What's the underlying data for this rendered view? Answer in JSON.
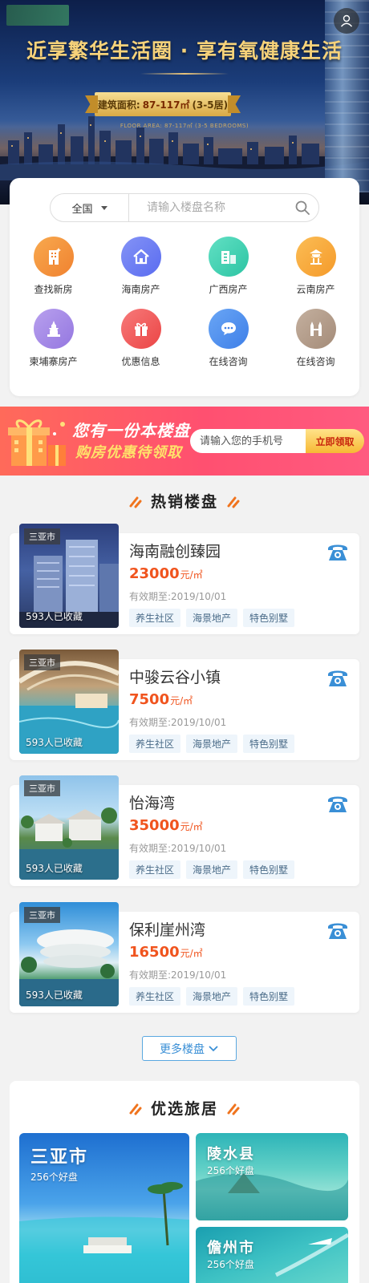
{
  "hero": {
    "headline": "近享繁华生活圈 · 享有氧健康生活",
    "area_label": "建筑面积:",
    "area_value": "87-117㎡",
    "area_suffix": "(3-5居)",
    "sub_text": "FLOOR AREA: 87-117㎡ (3-5 BEDROOMS)"
  },
  "search": {
    "region": "全国",
    "placeholder": "请输入楼盘名称"
  },
  "categories": [
    {
      "label": "查找新房",
      "color": "#f5923a",
      "icon": "building-icon"
    },
    {
      "label": "海南房产",
      "color": "#6b7ff0",
      "icon": "house-icon"
    },
    {
      "label": "广西房产",
      "color": "#3fd3b4",
      "icon": "buildings-icon"
    },
    {
      "label": "云南房产",
      "color": "#f7a83a",
      "icon": "pavilion-icon"
    },
    {
      "label": "柬埔寨房产",
      "color": "#a88be8",
      "icon": "temple-icon"
    },
    {
      "label": "优惠信息",
      "color": "#f05a5a",
      "icon": "gift-icon"
    },
    {
      "label": "在线咨询",
      "color": "#4a8ef0",
      "icon": "chat-icon"
    },
    {
      "label": "在线咨询",
      "color": "#b49c8a",
      "icon": "towers-icon"
    }
  ],
  "promo": {
    "line1": "您有一份本楼盘",
    "line2": "购房优惠待领取",
    "phone_placeholder": "请输入您的手机号",
    "button": "立即领取"
  },
  "hot_section": {
    "title": "热销楼盘"
  },
  "listings": [
    {
      "city": "三亚市",
      "favorites": "593人已收藏",
      "name": "海南融创臻园",
      "price": "23000",
      "unit": "元/㎡",
      "valid": "有效期至:2019/10/01",
      "tags": [
        "养生社区",
        "海景地产",
        "特色别墅"
      ]
    },
    {
      "city": "三亚市",
      "favorites": "593人已收藏",
      "name": "中骏云谷小镇",
      "price": "7500",
      "unit": "元/㎡",
      "valid": "有效期至:2019/10/01",
      "tags": [
        "养生社区",
        "海景地产",
        "特色别墅"
      ]
    },
    {
      "city": "三亚市",
      "favorites": "593人已收藏",
      "name": "怡海湾",
      "price": "35000",
      "unit": "元/㎡",
      "valid": "有效期至:2019/10/01",
      "tags": [
        "养生社区",
        "海景地产",
        "特色别墅"
      ]
    },
    {
      "city": "三亚市",
      "favorites": "593人已收藏",
      "name": "保利崖州湾",
      "price": "16500",
      "unit": "元/㎡",
      "valid": "有效期至:2019/10/01",
      "tags": [
        "养生社区",
        "海景地产",
        "特色别墅"
      ]
    }
  ],
  "more_button": "更多楼盘",
  "travel_section": {
    "title": "优选旅居",
    "tiles": [
      {
        "name": "三亚市",
        "count": "256个好盘"
      },
      {
        "name": "陵水县",
        "count": "256个好盘"
      },
      {
        "name": "儋州市",
        "count": "256个好盘"
      }
    ]
  },
  "colors": {
    "price": "#f0541e",
    "accent_blue": "#3a8fd6",
    "promo_red": "#ff5070",
    "slash_orange": "#f0741e"
  }
}
